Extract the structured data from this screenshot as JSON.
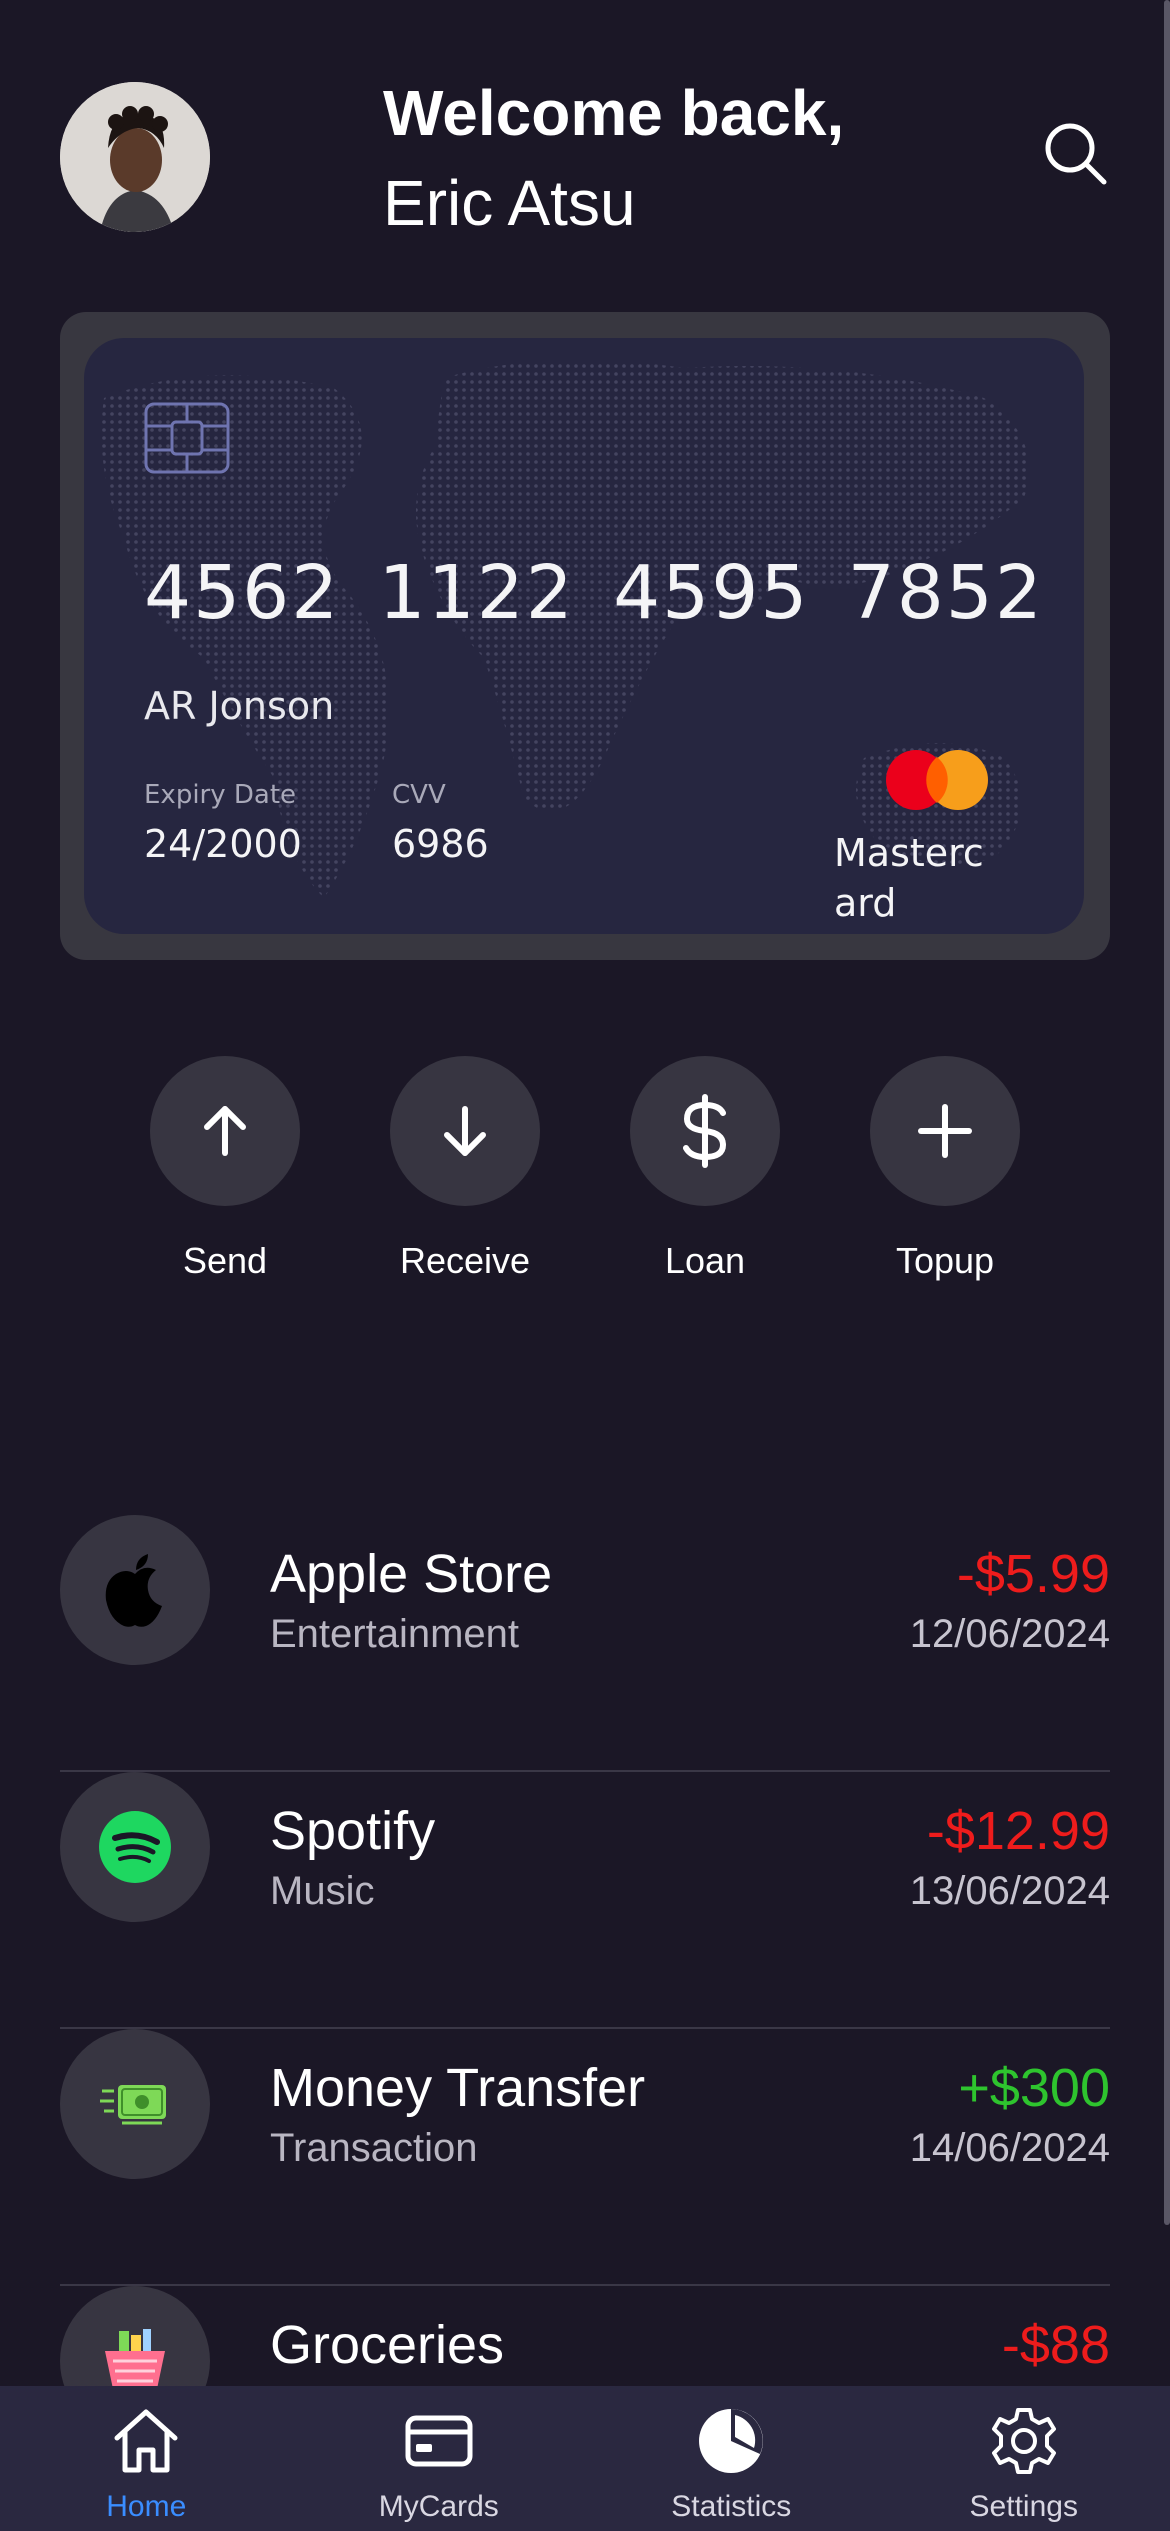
{
  "header": {
    "greeting": "Welcome back,",
    "user_name": "Eric Atsu"
  },
  "card": {
    "number_groups": [
      "4562",
      "1122",
      "4595",
      "7852"
    ],
    "holder_name": "AR Jonson",
    "expiry_label": "Expiry Date",
    "expiry_value": "24/2000",
    "cvv_label": "CVV",
    "cvv_value": "6986",
    "network": "Mastercard"
  },
  "actions": [
    {
      "label": "Send",
      "icon": "arrow-up-icon"
    },
    {
      "label": "Receive",
      "icon": "arrow-down-icon"
    },
    {
      "label": "Loan",
      "icon": "dollar-icon"
    },
    {
      "label": "Topup",
      "icon": "plus-icon"
    }
  ],
  "transactions": [
    {
      "title": "Apple Store",
      "category": "Entertainment",
      "amount": "-$5.99",
      "date": "12/06/2024",
      "icon": "apple-icon"
    },
    {
      "title": "Spotify",
      "category": "Music",
      "amount": "-$12.99",
      "date": "13/06/2024",
      "icon": "spotify-icon"
    },
    {
      "title": "Money Transfer",
      "category": "Transaction",
      "amount": "+$300",
      "date": "14/06/2024",
      "icon": "money-transfer-icon"
    },
    {
      "title": "Groceries",
      "category": "",
      "amount": "-$88",
      "date": "",
      "icon": "grocery-basket-icon"
    }
  ],
  "nav": [
    {
      "label": "Home",
      "icon": "home-icon",
      "active": true
    },
    {
      "label": "MyCards",
      "icon": "card-icon",
      "active": false
    },
    {
      "label": "Statistics",
      "icon": "pie-chart-icon",
      "active": false
    },
    {
      "label": "Settings",
      "icon": "gear-icon",
      "active": false
    }
  ],
  "colors": {
    "background": "#1b1726",
    "negative": "#ee1c1c",
    "positive": "#2ec42e",
    "nav_active": "#3a8dff"
  }
}
